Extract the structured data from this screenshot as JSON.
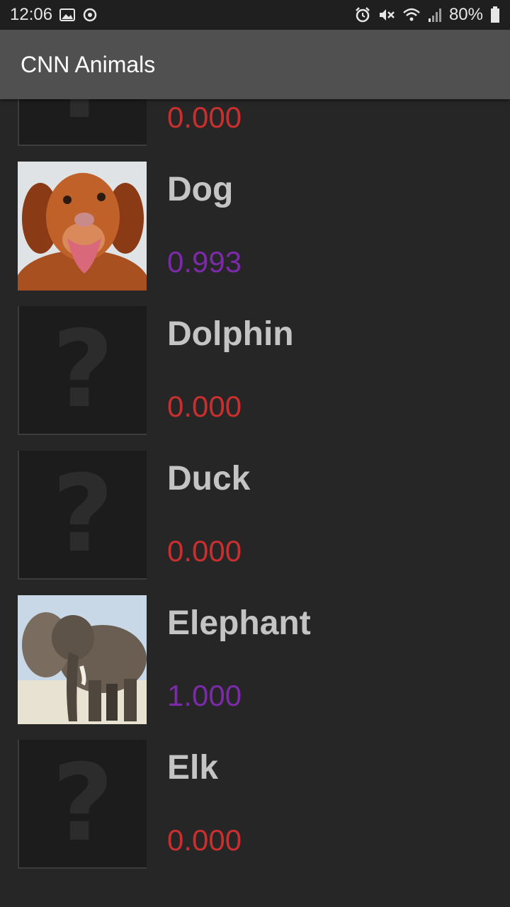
{
  "status_bar": {
    "time": "12:06",
    "battery": "80%",
    "icons_left": [
      "image-icon",
      "sync-icon"
    ],
    "icons_right": [
      "alarm-icon",
      "mute-icon",
      "wifi-icon",
      "signal-icon",
      "battery-icon"
    ]
  },
  "app_bar": {
    "title": "CNN Animals"
  },
  "colors": {
    "low_score": "#c8302f",
    "high_score": "#7b2aa8",
    "label": "#c4c4c4",
    "app_bar": "#505050",
    "background": "#262626"
  },
  "items": [
    {
      "name": "",
      "score": "0.000",
      "image": "placeholder-question-icon",
      "score_color": "red"
    },
    {
      "name": "Dog",
      "score": "0.993",
      "image": "dog-photo",
      "score_color": "purple"
    },
    {
      "name": "Dolphin",
      "score": "0.000",
      "image": "placeholder-question-icon",
      "score_color": "red"
    },
    {
      "name": "Duck",
      "score": "0.000",
      "image": "placeholder-question-icon",
      "score_color": "red"
    },
    {
      "name": "Elephant",
      "score": "1.000",
      "image": "elephant-photo",
      "score_color": "purple"
    },
    {
      "name": "Elk",
      "score": "0.000",
      "image": "placeholder-question-icon",
      "score_color": "red"
    }
  ]
}
